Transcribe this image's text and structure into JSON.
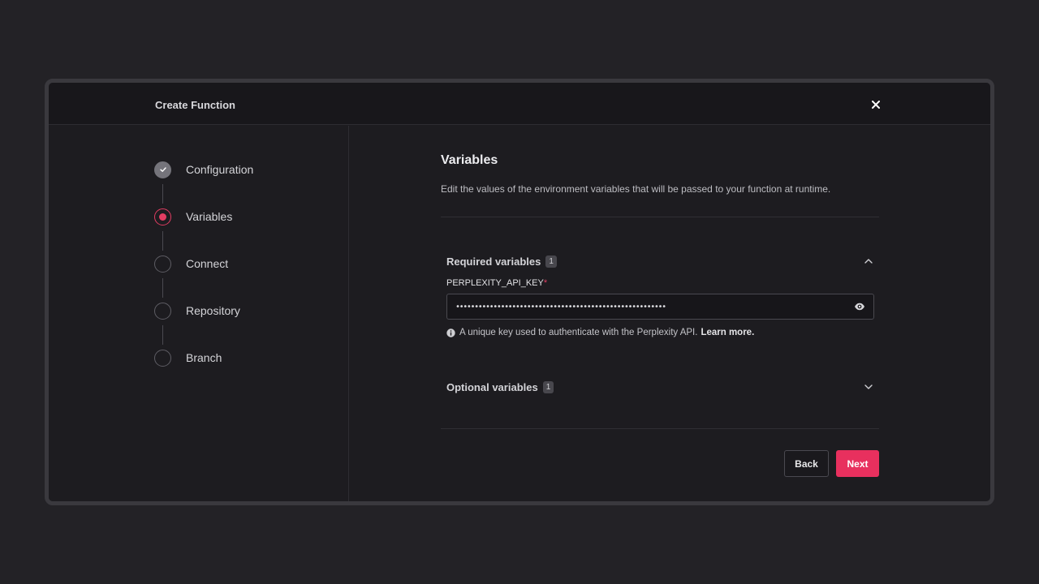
{
  "dialog": {
    "title": "Create Function",
    "close_icon": "close-icon"
  },
  "steps": [
    {
      "label": "Configuration",
      "state": "completed"
    },
    {
      "label": "Variables",
      "state": "active"
    },
    {
      "label": "Connect",
      "state": "pending"
    },
    {
      "label": "Repository",
      "state": "pending"
    },
    {
      "label": "Branch",
      "state": "pending"
    }
  ],
  "main": {
    "title": "Variables",
    "subtitle": "Edit the values of the environment variables that will be passed to your function at runtime.",
    "required": {
      "title": "Required variables",
      "count": "1",
      "expanded": true
    },
    "field": {
      "label": "PERPLEXITY_API_KEY",
      "required_mark": "*",
      "value": "••••••••••••••••••••••••••••••••••••••••••••••••••••••••",
      "hint": "A unique key used to authenticate with the Perplexity API.",
      "hint_link": "Learn more."
    },
    "optional": {
      "title": "Optional variables",
      "count": "1",
      "expanded": false
    }
  },
  "buttons": {
    "back": "Back",
    "next": "Next"
  },
  "colors": {
    "accent": "#e8305e",
    "background": "#232226",
    "panel": "#1d1c20"
  }
}
